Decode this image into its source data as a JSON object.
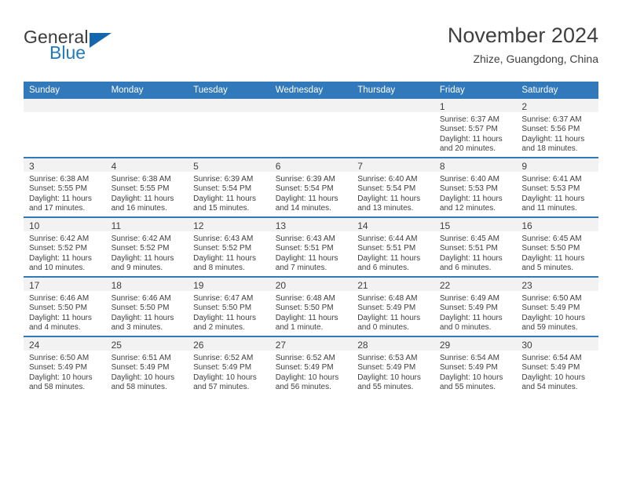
{
  "brand": {
    "name_part1": "General",
    "name_part2": "Blue",
    "triangle_color": "#1666ad",
    "blue_color": "#1f7bc1"
  },
  "header": {
    "title": "November 2024",
    "subtitle": "Zhize, Guangdong, China"
  },
  "theme": {
    "header_blue": "#3179bb",
    "daynum_band": "#f2f2f2",
    "text": "#404040"
  },
  "calendar": {
    "weekday_headers": [
      "Sunday",
      "Monday",
      "Tuesday",
      "Wednesday",
      "Thursday",
      "Friday",
      "Saturday"
    ],
    "weeks": [
      [
        {
          "day": "",
          "sunrise": "",
          "sunset": "",
          "daylight": ""
        },
        {
          "day": "",
          "sunrise": "",
          "sunset": "",
          "daylight": ""
        },
        {
          "day": "",
          "sunrise": "",
          "sunset": "",
          "daylight": ""
        },
        {
          "day": "",
          "sunrise": "",
          "sunset": "",
          "daylight": ""
        },
        {
          "day": "",
          "sunrise": "",
          "sunset": "",
          "daylight": ""
        },
        {
          "day": "1",
          "sunrise": "Sunrise: 6:37 AM",
          "sunset": "Sunset: 5:57 PM",
          "daylight": "Daylight: 11 hours and 20 minutes."
        },
        {
          "day": "2",
          "sunrise": "Sunrise: 6:37 AM",
          "sunset": "Sunset: 5:56 PM",
          "daylight": "Daylight: 11 hours and 18 minutes."
        }
      ],
      [
        {
          "day": "3",
          "sunrise": "Sunrise: 6:38 AM",
          "sunset": "Sunset: 5:55 PM",
          "daylight": "Daylight: 11 hours and 17 minutes."
        },
        {
          "day": "4",
          "sunrise": "Sunrise: 6:38 AM",
          "sunset": "Sunset: 5:55 PM",
          "daylight": "Daylight: 11 hours and 16 minutes."
        },
        {
          "day": "5",
          "sunrise": "Sunrise: 6:39 AM",
          "sunset": "Sunset: 5:54 PM",
          "daylight": "Daylight: 11 hours and 15 minutes."
        },
        {
          "day": "6",
          "sunrise": "Sunrise: 6:39 AM",
          "sunset": "Sunset: 5:54 PM",
          "daylight": "Daylight: 11 hours and 14 minutes."
        },
        {
          "day": "7",
          "sunrise": "Sunrise: 6:40 AM",
          "sunset": "Sunset: 5:54 PM",
          "daylight": "Daylight: 11 hours and 13 minutes."
        },
        {
          "day": "8",
          "sunrise": "Sunrise: 6:40 AM",
          "sunset": "Sunset: 5:53 PM",
          "daylight": "Daylight: 11 hours and 12 minutes."
        },
        {
          "day": "9",
          "sunrise": "Sunrise: 6:41 AM",
          "sunset": "Sunset: 5:53 PM",
          "daylight": "Daylight: 11 hours and 11 minutes."
        }
      ],
      [
        {
          "day": "10",
          "sunrise": "Sunrise: 6:42 AM",
          "sunset": "Sunset: 5:52 PM",
          "daylight": "Daylight: 11 hours and 10 minutes."
        },
        {
          "day": "11",
          "sunrise": "Sunrise: 6:42 AM",
          "sunset": "Sunset: 5:52 PM",
          "daylight": "Daylight: 11 hours and 9 minutes."
        },
        {
          "day": "12",
          "sunrise": "Sunrise: 6:43 AM",
          "sunset": "Sunset: 5:52 PM",
          "daylight": "Daylight: 11 hours and 8 minutes."
        },
        {
          "day": "13",
          "sunrise": "Sunrise: 6:43 AM",
          "sunset": "Sunset: 5:51 PM",
          "daylight": "Daylight: 11 hours and 7 minutes."
        },
        {
          "day": "14",
          "sunrise": "Sunrise: 6:44 AM",
          "sunset": "Sunset: 5:51 PM",
          "daylight": "Daylight: 11 hours and 6 minutes."
        },
        {
          "day": "15",
          "sunrise": "Sunrise: 6:45 AM",
          "sunset": "Sunset: 5:51 PM",
          "daylight": "Daylight: 11 hours and 6 minutes."
        },
        {
          "day": "16",
          "sunrise": "Sunrise: 6:45 AM",
          "sunset": "Sunset: 5:50 PM",
          "daylight": "Daylight: 11 hours and 5 minutes."
        }
      ],
      [
        {
          "day": "17",
          "sunrise": "Sunrise: 6:46 AM",
          "sunset": "Sunset: 5:50 PM",
          "daylight": "Daylight: 11 hours and 4 minutes."
        },
        {
          "day": "18",
          "sunrise": "Sunrise: 6:46 AM",
          "sunset": "Sunset: 5:50 PM",
          "daylight": "Daylight: 11 hours and 3 minutes."
        },
        {
          "day": "19",
          "sunrise": "Sunrise: 6:47 AM",
          "sunset": "Sunset: 5:50 PM",
          "daylight": "Daylight: 11 hours and 2 minutes."
        },
        {
          "day": "20",
          "sunrise": "Sunrise: 6:48 AM",
          "sunset": "Sunset: 5:50 PM",
          "daylight": "Daylight: 11 hours and 1 minute."
        },
        {
          "day": "21",
          "sunrise": "Sunrise: 6:48 AM",
          "sunset": "Sunset: 5:49 PM",
          "daylight": "Daylight: 11 hours and 0 minutes."
        },
        {
          "day": "22",
          "sunrise": "Sunrise: 6:49 AM",
          "sunset": "Sunset: 5:49 PM",
          "daylight": "Daylight: 11 hours and 0 minutes."
        },
        {
          "day": "23",
          "sunrise": "Sunrise: 6:50 AM",
          "sunset": "Sunset: 5:49 PM",
          "daylight": "Daylight: 10 hours and 59 minutes."
        }
      ],
      [
        {
          "day": "24",
          "sunrise": "Sunrise: 6:50 AM",
          "sunset": "Sunset: 5:49 PM",
          "daylight": "Daylight: 10 hours and 58 minutes."
        },
        {
          "day": "25",
          "sunrise": "Sunrise: 6:51 AM",
          "sunset": "Sunset: 5:49 PM",
          "daylight": "Daylight: 10 hours and 58 minutes."
        },
        {
          "day": "26",
          "sunrise": "Sunrise: 6:52 AM",
          "sunset": "Sunset: 5:49 PM",
          "daylight": "Daylight: 10 hours and 57 minutes."
        },
        {
          "day": "27",
          "sunrise": "Sunrise: 6:52 AM",
          "sunset": "Sunset: 5:49 PM",
          "daylight": "Daylight: 10 hours and 56 minutes."
        },
        {
          "day": "28",
          "sunrise": "Sunrise: 6:53 AM",
          "sunset": "Sunset: 5:49 PM",
          "daylight": "Daylight: 10 hours and 55 minutes."
        },
        {
          "day": "29",
          "sunrise": "Sunrise: 6:54 AM",
          "sunset": "Sunset: 5:49 PM",
          "daylight": "Daylight: 10 hours and 55 minutes."
        },
        {
          "day": "30",
          "sunrise": "Sunrise: 6:54 AM",
          "sunset": "Sunset: 5:49 PM",
          "daylight": "Daylight: 10 hours and 54 minutes."
        }
      ]
    ]
  }
}
